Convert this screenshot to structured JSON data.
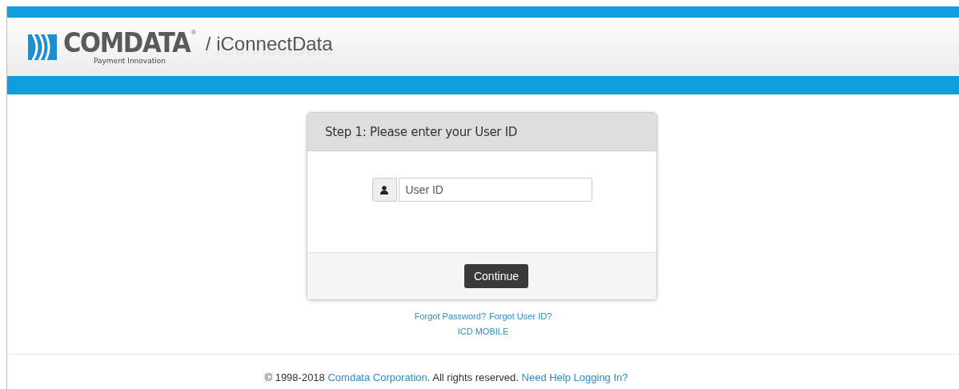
{
  "header": {
    "brand": "COMDATA",
    "registered": "®",
    "tagline": "Payment Innovation",
    "app_name": "/ iConnectData"
  },
  "login_card": {
    "title": "Step 1: Please enter your User ID",
    "user_field": {
      "placeholder": "User ID"
    },
    "button": "Continue"
  },
  "links": [
    {
      "label": "Forgot Password?"
    },
    {
      "label": "Forgot User ID?"
    }
  ],
  "mobile_link": "ICD MOBILE",
  "footer": {
    "copyright": "© 1998-2018",
    "company_link": "Comdata Corporation",
    "rights": ". All rights reserved.",
    "help_link": "Need Help Logging In?"
  }
}
